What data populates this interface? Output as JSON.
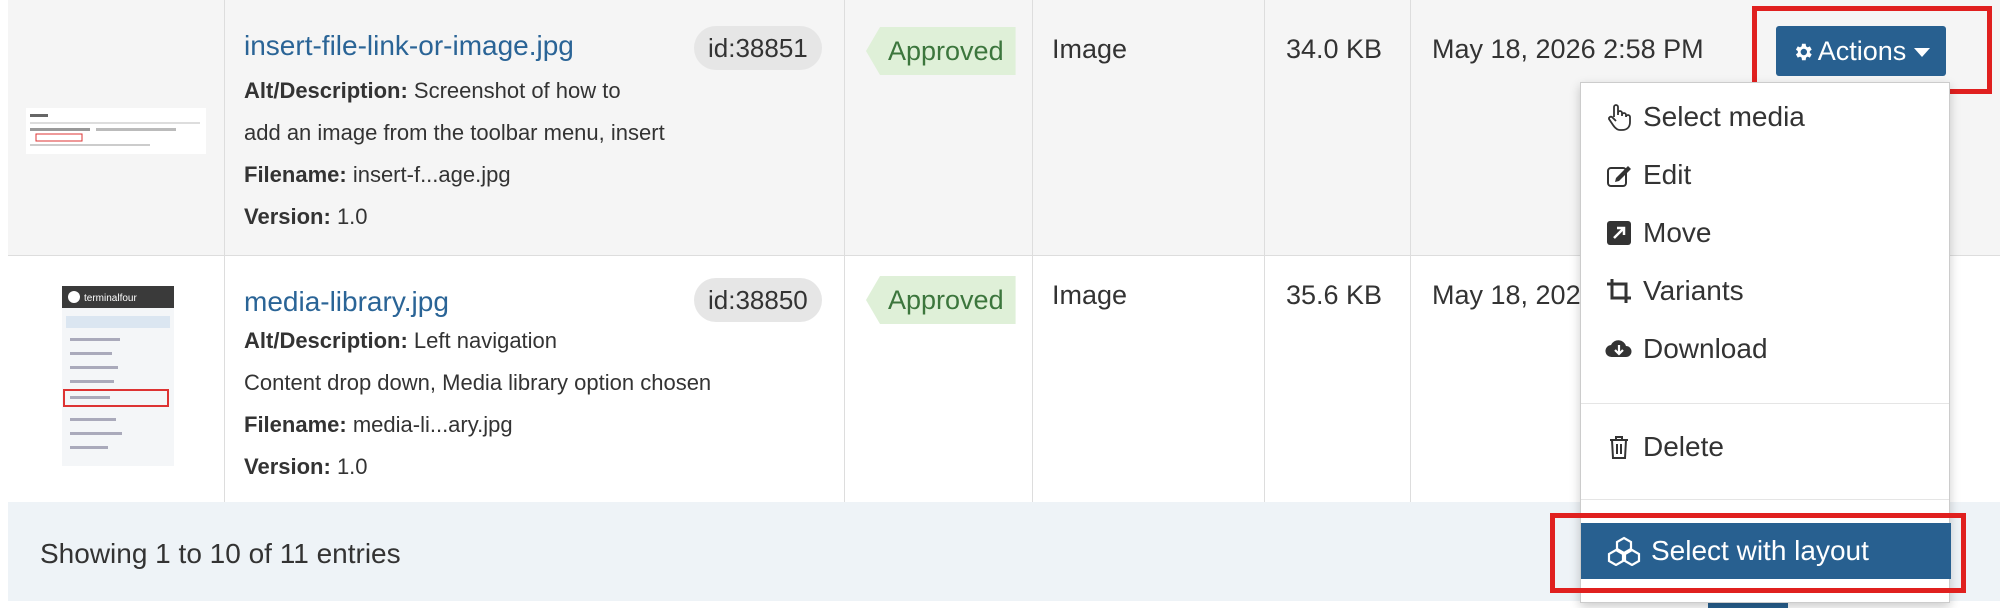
{
  "rows": [
    {
      "filename": "insert-file-link-or-image.jpg",
      "id": "id:38851",
      "alt_label": "Alt/Description:",
      "alt_line1": "Screenshot of how to",
      "alt_line2": "add an image from the toolbar menu, insert",
      "filename_label": "Filename:",
      "filename_short": "insert-f...age.jpg",
      "version_label": "Version:",
      "version": "1.0",
      "status": "Approved",
      "type": "Image",
      "size": "34.0 KB",
      "date": "May 18, 2026 2:58 PM"
    },
    {
      "filename": "media-library.jpg",
      "id": "id:38850",
      "alt_label": "Alt/Description:",
      "alt_line1": "Left navigation",
      "alt_line2": "Content drop down, Media library option chosen",
      "filename_label": "Filename:",
      "filename_short": "media-li...ary.jpg",
      "version_label": "Version:",
      "version": "1.0",
      "status": "Approved",
      "type": "Image",
      "size": "35.6 KB",
      "date": "May 18, 202"
    }
  ],
  "thumb2_logo": "terminalfour",
  "footer": {
    "showing": "Showing 1 to 10 of 11 entries"
  },
  "actions": {
    "label": "Actions",
    "menu": {
      "select_media": "Select media",
      "edit": "Edit",
      "move": "Move",
      "variants": "Variants",
      "download": "Download",
      "delete": "Delete",
      "select_with_layout": "Select with layout"
    }
  },
  "colors": {
    "primary": "#286090",
    "link": "#2a6496",
    "approved_bg": "#dff0d8",
    "approved_text": "#3c763d",
    "highlight": "#e0201f"
  }
}
